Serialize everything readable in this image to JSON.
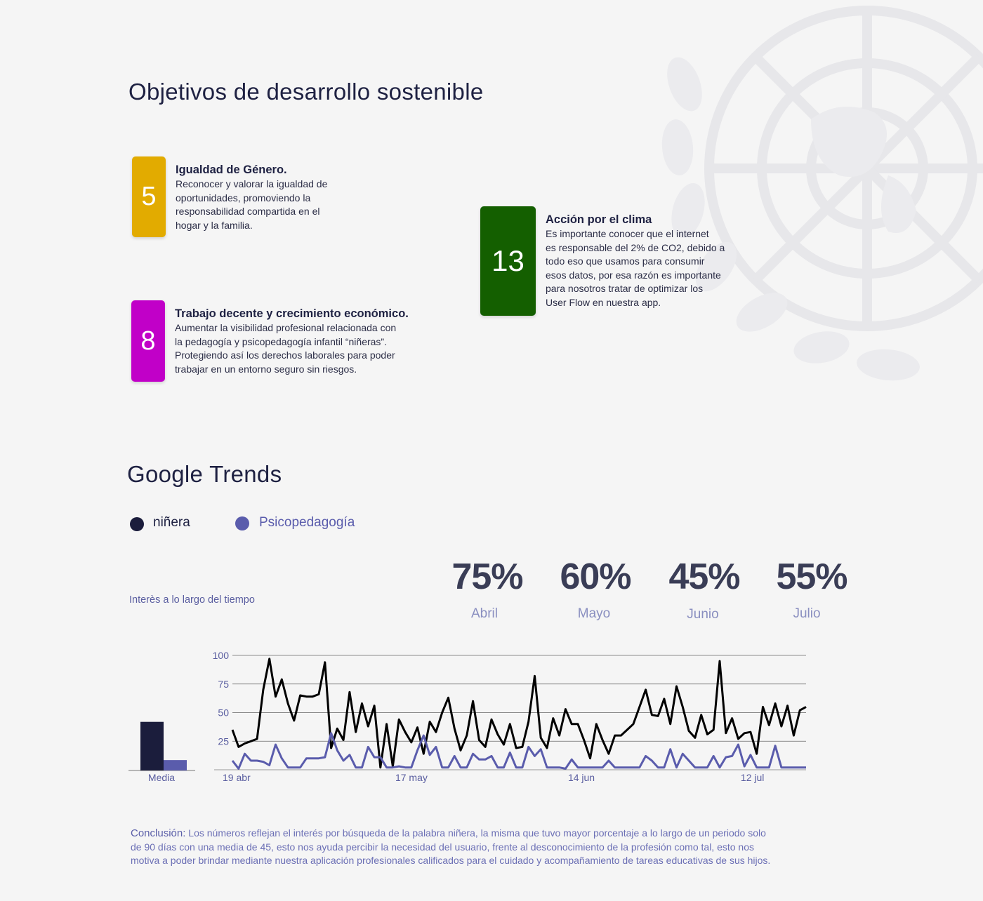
{
  "sections": {
    "sdg_title": "Objetivos de desarrollo sostenible",
    "trends_title": "Google Trends"
  },
  "goals": [
    {
      "number": "5",
      "title": "Igualdad de Género.",
      "lines": [
        "Reconocer y valorar la igualdad de",
        "oportunidades, promoviendo la",
        "responsabilidad compartida en el",
        "hogar y la familia."
      ],
      "color": "#e2ab00"
    },
    {
      "number": "8",
      "title": "Trabajo decente y crecimiento económico.",
      "lines": [
        "Aumentar la visibilidad profesional relacionada con",
        "la pedagogía y psicopedagogía infantil “niñeras”.",
        "Protegiendo así los derechos laborales para poder",
        "trabajar en un entorno seguro sin riesgos."
      ],
      "color": "#c100c8"
    },
    {
      "number": "13",
      "title": "Acción por el clima",
      "lines": [
        "Es importante conocer que el internet",
        "es responsable del 2% de CO2, debido a",
        "todo eso que usamos para consumir",
        "esos datos, por esa razón es importante",
        "para nosotros tratar de optimizar los",
        "User Flow en nuestra app."
      ],
      "color": "#145f00"
    }
  ],
  "legend": [
    {
      "label": "niñera",
      "color": "#1b1d3c"
    },
    {
      "label": "Psicopedagogía",
      "color": "#5a5cac"
    }
  ],
  "interest_label": "Interès a lo largo del tiempo",
  "monthly_stats": [
    {
      "value": "75%",
      "month": "Abril"
    },
    {
      "value": "60%",
      "month": "Mayo"
    },
    {
      "value": "45%",
      "month": "Junio"
    },
    {
      "value": "55%",
      "month": "Julio"
    }
  ],
  "chart_data": [
    {
      "type": "bar",
      "categories": [
        "Media"
      ],
      "series": [
        {
          "name": "niñera",
          "values": [
            42
          ],
          "color": "#1b1d3c"
        },
        {
          "name": "Psicopedagogía",
          "values": [
            9
          ],
          "color": "#5a5cac"
        }
      ],
      "ylim": [
        0,
        100
      ]
    },
    {
      "type": "line",
      "xlabel": "",
      "ylabel": "",
      "ylim": [
        0,
        100
      ],
      "yticks": [
        25,
        50,
        75,
        100
      ],
      "grid": true,
      "x_tick_labels": [
        {
          "label": "19 abr",
          "index": 0
        },
        {
          "label": "17 may",
          "index": 28
        },
        {
          "label": "14 jun",
          "index": 56
        },
        {
          "label": "12 jul",
          "index": 84
        }
      ],
      "series": [
        {
          "name": "niñera",
          "color": "#000000",
          "values": [
            35,
            20,
            23,
            25,
            27,
            70,
            97,
            64,
            79,
            58,
            43,
            65,
            64,
            64,
            66,
            94,
            19,
            36,
            26,
            68,
            33,
            58,
            38,
            56,
            2,
            40,
            3,
            44,
            33,
            24,
            37,
            14,
            42,
            33,
            50,
            63,
            36,
            17,
            30,
            60,
            26,
            20,
            44,
            31,
            22,
            40,
            19,
            20,
            42,
            82,
            28,
            19,
            45,
            30,
            53,
            40,
            40,
            26,
            10,
            40,
            26,
            14,
            30,
            30,
            35,
            40,
            55,
            70,
            48,
            47,
            62,
            40,
            73,
            55,
            34,
            28,
            48,
            31,
            35,
            95,
            32,
            45,
            27,
            32,
            33,
            14,
            55,
            39,
            58,
            38,
            56,
            30,
            52,
            55
          ]
        },
        {
          "name": "Psicopedagogía",
          "color": "#5a5cac",
          "values": [
            8,
            1,
            14,
            8,
            8,
            7,
            4,
            22,
            10,
            2,
            2,
            2,
            10,
            10,
            10,
            11,
            32,
            17,
            8,
            13,
            2,
            2,
            20,
            11,
            11,
            2,
            2,
            3,
            2,
            2,
            17,
            30,
            13,
            20,
            2,
            2,
            12,
            2,
            2,
            14,
            9,
            9,
            12,
            2,
            2,
            15,
            2,
            2,
            20,
            12,
            18,
            2,
            2,
            2,
            1,
            9,
            2,
            2,
            2,
            2,
            2,
            8,
            2,
            2,
            2,
            2,
            2,
            12,
            8,
            2,
            2,
            18,
            2,
            14,
            8,
            2,
            2,
            2,
            12,
            2,
            11,
            12,
            22,
            3,
            13,
            2,
            2,
            2,
            21,
            2,
            2,
            2,
            2,
            2
          ]
        }
      ]
    }
  ],
  "chart_labels": {
    "media": "Media"
  },
  "conclusion": {
    "lead": "Conclusión:",
    "lines": [
      " Los números reflejan el interés por búsqueda de la palabra niñera, la misma que tuvo mayor porcentaje a lo largo de un periodo solo",
      "de 90 días con una media de 45, esto nos ayuda percibir la necesidad del usuario, frente al desconocimiento de la profesión como tal, esto nos",
      "motiva a poder brindar mediante nuestra aplicación profesionales calificados para el cuidado y acompañamiento de tareas educativas de sus hijos."
    ]
  }
}
